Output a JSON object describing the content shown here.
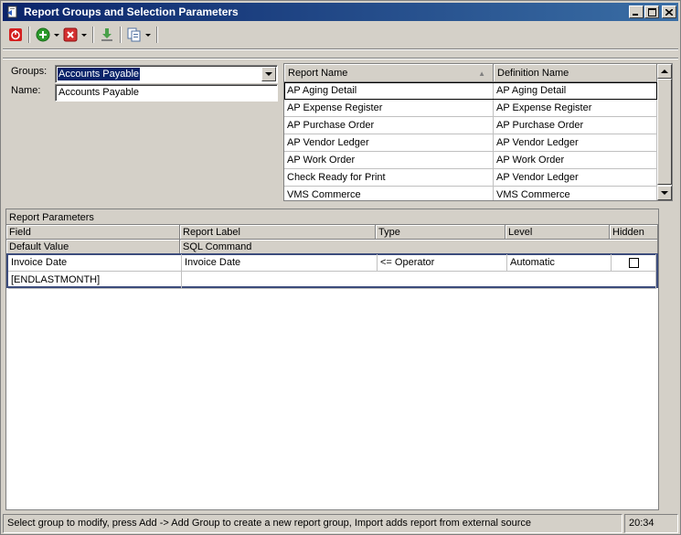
{
  "window": {
    "title": "Report Groups and Selection Parameters",
    "controls": {
      "minimize": "_",
      "maximize": "□",
      "close": "✕"
    }
  },
  "toolbar": {
    "icons": [
      "power-icon",
      "add-icon",
      "delete-icon",
      "import-icon",
      "copy-icon"
    ]
  },
  "form": {
    "groups_label": "Groups:",
    "groups_value": "Accounts Payable",
    "name_label": "Name:",
    "name_value": "Accounts Payable"
  },
  "reports_grid": {
    "columns": [
      "Report Name",
      "Definition Name"
    ],
    "rows": [
      [
        "AP Aging Detail",
        "AP Aging Detail"
      ],
      [
        "AP Expense Register",
        "AP Expense Register"
      ],
      [
        "AP Purchase Order",
        "AP Purchase Order"
      ],
      [
        "AP Vendor Ledger",
        "AP Vendor Ledger"
      ],
      [
        "AP Work Order",
        "AP Work Order"
      ],
      [
        "Check Ready for Print",
        "AP Vendor Ledger"
      ],
      [
        "VMS Commerce",
        "VMS Commerce"
      ]
    ]
  },
  "params": {
    "caption": "Report Parameters",
    "header1": [
      "Field",
      "Report Label",
      "Type",
      "Level",
      "Hidden"
    ],
    "header2": [
      "Default Value",
      "SQL Command"
    ],
    "record": {
      "field": "Invoice Date",
      "report_label": "Invoice Date",
      "type": "<= Operator",
      "level": "Automatic",
      "hidden": false,
      "default_value": "[ENDLASTMONTH]",
      "sql_command": ""
    }
  },
  "status": {
    "message": "Select group to modify, press Add -> Add Group to create a new report group, Import adds report from external source",
    "time": "20:34"
  }
}
